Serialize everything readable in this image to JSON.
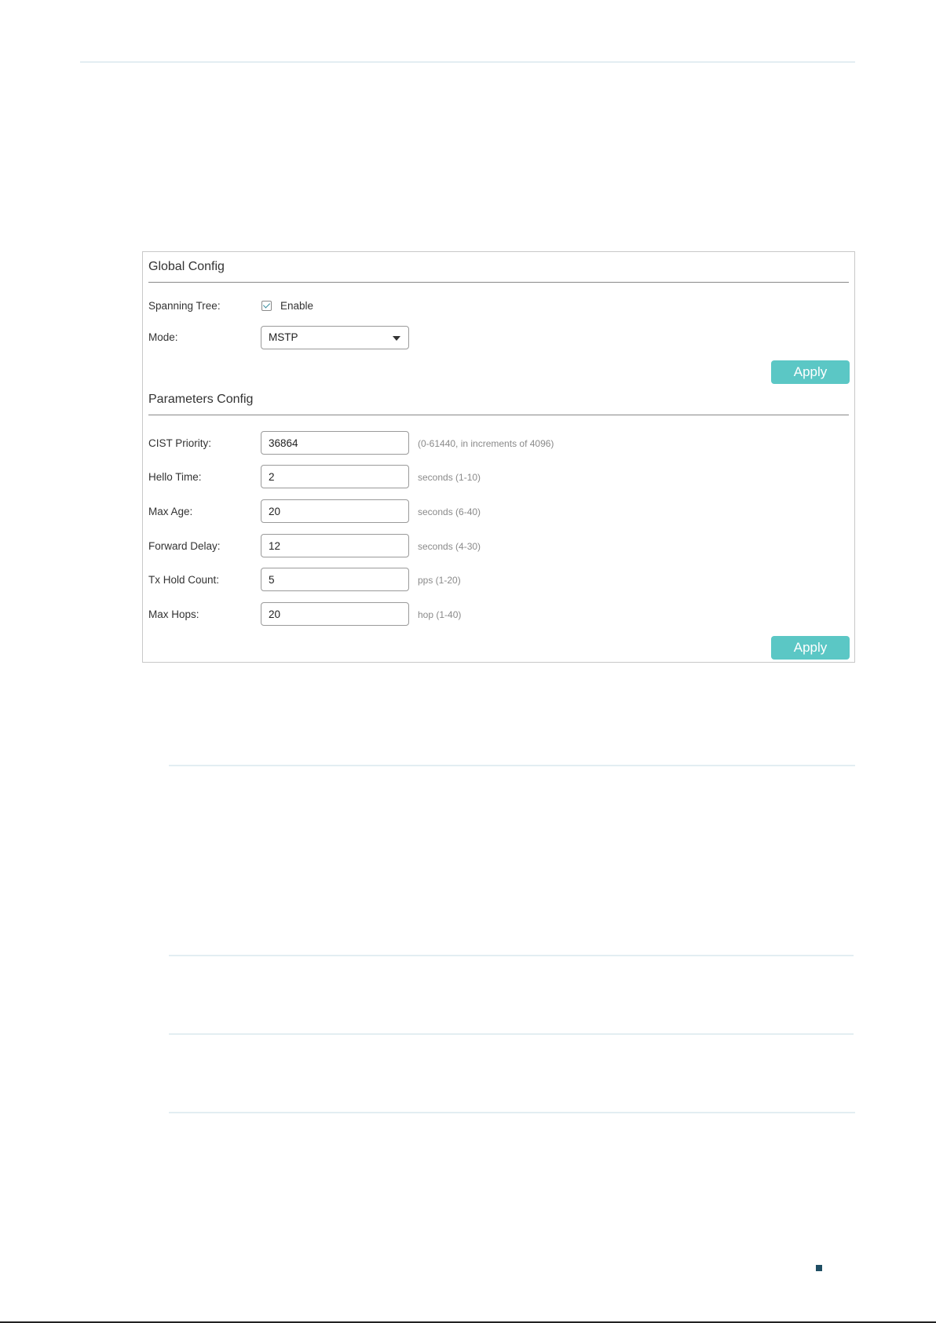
{
  "global_config": {
    "title": "Global Config",
    "spanning_tree_label": "Spanning Tree:",
    "spanning_tree_checkbox_label": "Enable",
    "spanning_tree_enabled": true,
    "mode_label": "Mode:",
    "mode_value": "MSTP",
    "apply_label": "Apply"
  },
  "parameters_config": {
    "title": "Parameters Config",
    "rows": [
      {
        "label": "CIST Priority:",
        "value": "36864",
        "hint": "(0-61440, in increments of 4096)"
      },
      {
        "label": "Hello Time:",
        "value": "2",
        "hint": "seconds (1-10)"
      },
      {
        "label": "Max Age:",
        "value": "20",
        "hint": "seconds (6-40)"
      },
      {
        "label": "Forward Delay:",
        "value": "12",
        "hint": "seconds (4-30)"
      },
      {
        "label": "Tx Hold Count:",
        "value": "5",
        "hint": "pps (1-20)"
      },
      {
        "label": "Max Hops:",
        "value": "20",
        "hint": "hop (1-40)"
      }
    ],
    "apply_label": "Apply"
  },
  "colors": {
    "accent": "#5bc7c5",
    "marker": "#1f4e64"
  }
}
